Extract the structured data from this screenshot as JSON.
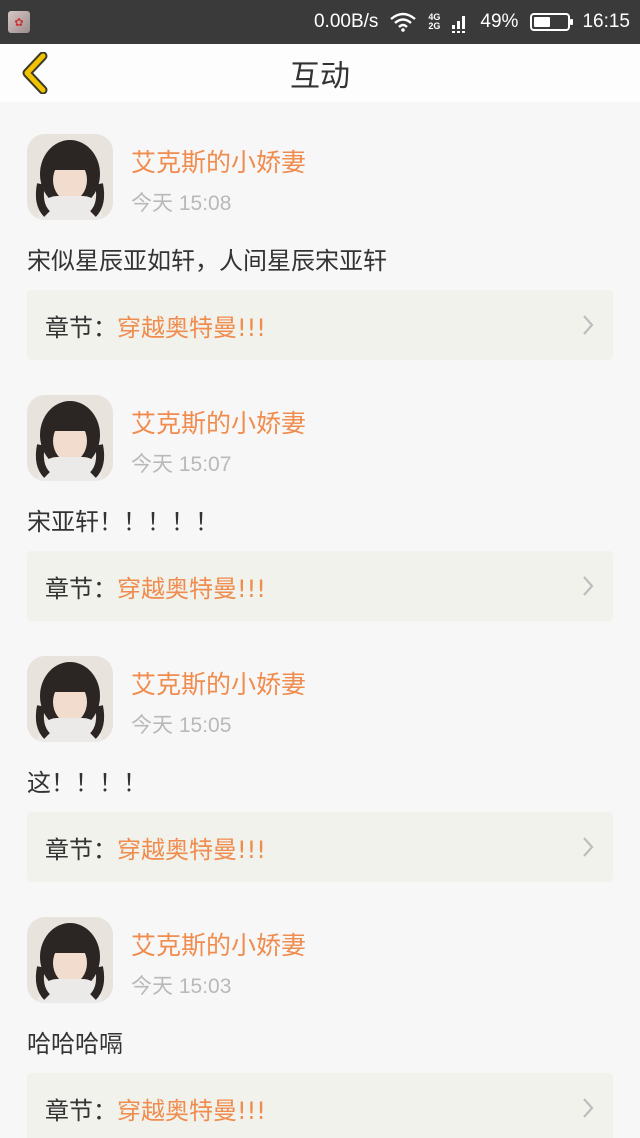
{
  "status_bar": {
    "net_speed": "0.00B/s",
    "net_type_top": "4G",
    "net_type_bottom": "2G",
    "battery_percent": "49%",
    "battery_level": 0.49,
    "time": "16:15",
    "icons": [
      "app-thumbnail-icon",
      "wifi-icon",
      "signal-icon",
      "battery-icon"
    ]
  },
  "header": {
    "title": "互动",
    "back_icon": "chevron-left-icon",
    "accent_color": "#f2c200"
  },
  "colors": {
    "username": "#ef8c4e",
    "chapter_name": "#ef8c4e",
    "timestamp": "#b9b9b9",
    "card_bg": "#f2f2ec"
  },
  "posts": [
    {
      "user_name": "艾克斯的小娇妻",
      "time": "今天 15:08",
      "text": "宋似星辰亚如轩，人间星辰宋亚轩",
      "chapter_label": "章节：",
      "chapter_name": "穿越奥特曼!!!"
    },
    {
      "user_name": "艾克斯的小娇妻",
      "time": "今天 15:07",
      "text": "宋亚轩！！！！！",
      "chapter_label": "章节：",
      "chapter_name": "穿越奥特曼!!!"
    },
    {
      "user_name": "艾克斯的小娇妻",
      "time": "今天 15:05",
      "text": "这！！！！",
      "chapter_label": "章节：",
      "chapter_name": "穿越奥特曼!!!"
    },
    {
      "user_name": "艾克斯的小娇妻",
      "time": "今天 15:03",
      "text": "哈哈哈嗝",
      "chapter_label": "章节：",
      "chapter_name": "穿越奥特曼!!!"
    }
  ]
}
